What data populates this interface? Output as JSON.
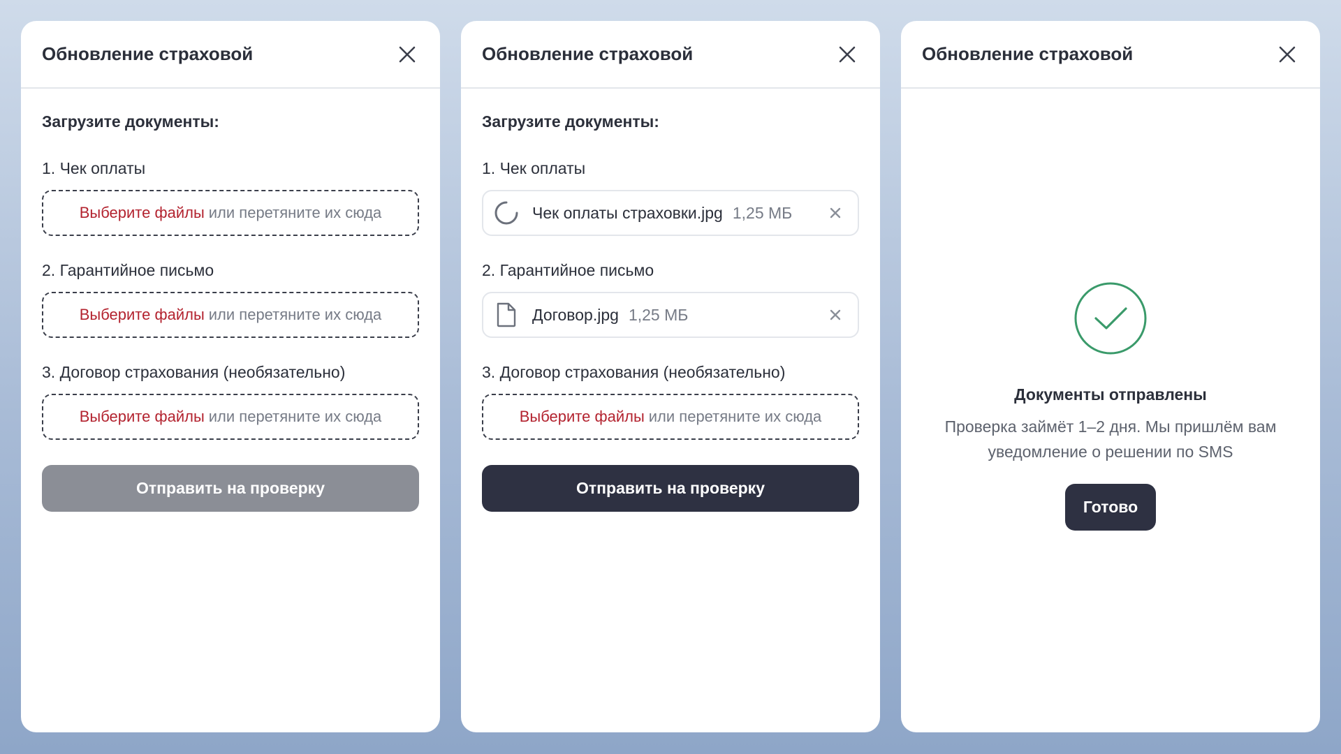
{
  "colors": {
    "accent_link": "#b3232f",
    "primary_button": "#2e3142",
    "disabled_button": "#8b8e96",
    "success": "#3a9a6a"
  },
  "panels": [
    {
      "title": "Обновление страховой",
      "upload_title": "Загрузите документы:",
      "sections": [
        {
          "label": "1. Чек оплаты",
          "dropzone_link": "Выберите файлы",
          "dropzone_rest": "или перетяните их сюда"
        },
        {
          "label": "2. Гарантийное письмо",
          "dropzone_link": "Выберите файлы",
          "dropzone_rest": "или перетяните их сюда"
        },
        {
          "label": "3. Договор страхования (необязательно)",
          "dropzone_link": "Выберите файлы",
          "dropzone_rest": "или перетяните их сюда"
        }
      ],
      "submit_label": "Отправить на проверку",
      "submit_state": "disabled"
    },
    {
      "title": "Обновление страховой",
      "upload_title": "Загрузите документы:",
      "sections": [
        {
          "label": "1. Чек оплаты",
          "file": {
            "name": "Чек оплаты страховки.jpg",
            "size": "1,25 МБ",
            "icon": "loading-spinner-icon"
          }
        },
        {
          "label": "2. Гарантийное письмо",
          "file": {
            "name": "Договор.jpg",
            "size": "1,25 МБ",
            "icon": "document-icon"
          }
        },
        {
          "label": "3. Договор страхования (необязательно)",
          "dropzone_link": "Выберите файлы",
          "dropzone_rest": "или перетяните их сюда"
        }
      ],
      "submit_label": "Отправить на проверку",
      "submit_state": "active"
    },
    {
      "title": "Обновление страховой",
      "success": {
        "icon": "check-circle-icon",
        "title": "Документы отправлены",
        "text": "Проверка займёт 1–2 дня. Мы пришлём вам уведомление о решении по SMS",
        "button_label": "Готово"
      }
    }
  ]
}
